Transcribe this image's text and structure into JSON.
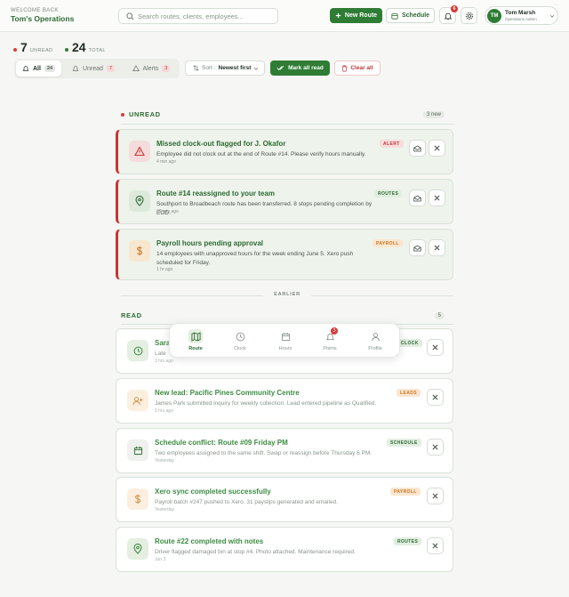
{
  "header": {
    "welcome": "WELCOME BACK",
    "org": "Tom's Operations",
    "search_placeholder": "Search routes, clients, employees...",
    "new_route": "New Route",
    "schedule": "Schedule",
    "bell_badge": "6",
    "user_initials": "TM",
    "user_name": "Tom Marsh",
    "user_role": "Operations Admin"
  },
  "stats": {
    "unread_count": "7",
    "unread_label": "UNREAD",
    "total_count": "24",
    "total_label": "TOTAL"
  },
  "tabs": [
    {
      "label": "All",
      "count": "24"
    },
    {
      "label": "Unread",
      "count": "7"
    },
    {
      "label": "Alerts",
      "count": "3"
    }
  ],
  "toolbar": {
    "sort_prefix": "Sort :",
    "sort_value": "Newest first",
    "mark_all": "Mark all read",
    "clear_all": "Clear all"
  },
  "sections": {
    "unread": {
      "label": "UNREAD",
      "pill": "3 new"
    },
    "earlier": "EARLIER",
    "read": {
      "label": "READ",
      "pill": "5"
    }
  },
  "unread_items": [
    {
      "title": "Missed clock-out flagged for J. Okafor",
      "body": "Employee did not clock out at the end of Route #14. Please verify hours manually.",
      "time": "4 min ago",
      "tag": "ALERT",
      "icon": "alert-icon"
    },
    {
      "title": "Route #14 reassigned to your team",
      "body": "Southport to Broadbeach route has been transferred. 8 stops pending completion by EOD.",
      "time": "32 min ago",
      "tag": "ROUTES",
      "icon": "pin-icon"
    },
    {
      "title": "Payroll hours pending approval",
      "body": "14 employees with unapproved hours for the week ending June 5. Xero push scheduled for Friday.",
      "time": "1 hr ago",
      "tag": "PAYROLL",
      "icon": "dollar-icon"
    }
  ],
  "read_items": [
    {
      "title": "Sara",
      "body": "Late",
      "time": "3 hrs ago",
      "tag": "CLOCK",
      "icon": "clock-icon"
    },
    {
      "title": "New lead: Pacific Pines Community Centre",
      "body": "James Park submitted inquiry for weekly collection. Lead entered pipeline as Qualified.",
      "time": "5 hrs ago",
      "tag": "LEADS",
      "icon": "user-plus-icon"
    },
    {
      "title": "Schedule conflict: Route #09 Friday PM",
      "body": "Two employees assigned to the same shift. Swap or reassign before Thursday 6 PM.",
      "time": "Yesterday",
      "tag": "SCHEDULE",
      "icon": "calendar-icon"
    },
    {
      "title": "Xero sync completed successfully",
      "body": "Payroll batch #247 pushed to Xero. 31 payslips generated and emailed.",
      "time": "Yesterday",
      "tag": "PAYROLL",
      "icon": "dollar-icon"
    },
    {
      "title": "Route #22 completed with notes",
      "body": "Driver flagged damaged bin at stop #4. Photo attached. Maintenance required.",
      "time": "Jun 3",
      "tag": "ROUTES",
      "icon": "pin-icon"
    }
  ],
  "bottom_nav": [
    {
      "label": "Route",
      "icon": "map-icon"
    },
    {
      "label": "Clock",
      "icon": "clock-icon"
    },
    {
      "label": "Hours",
      "icon": "calendar-icon"
    },
    {
      "label": "Points",
      "icon": "points-icon",
      "badge": "3"
    },
    {
      "label": "Profile",
      "icon": "person-icon"
    }
  ],
  "colors": {
    "brand": "#2f7d35",
    "alert": "#c93535",
    "tag_alert_bg": "#f9dcdc",
    "tag_alert_fg": "#c03a3a",
    "tag_routes_bg": "#e1eedf",
    "tag_routes_fg": "#2d6a33",
    "tag_payroll_bg": "#fbe6cf",
    "tag_payroll_fg": "#c77420"
  }
}
